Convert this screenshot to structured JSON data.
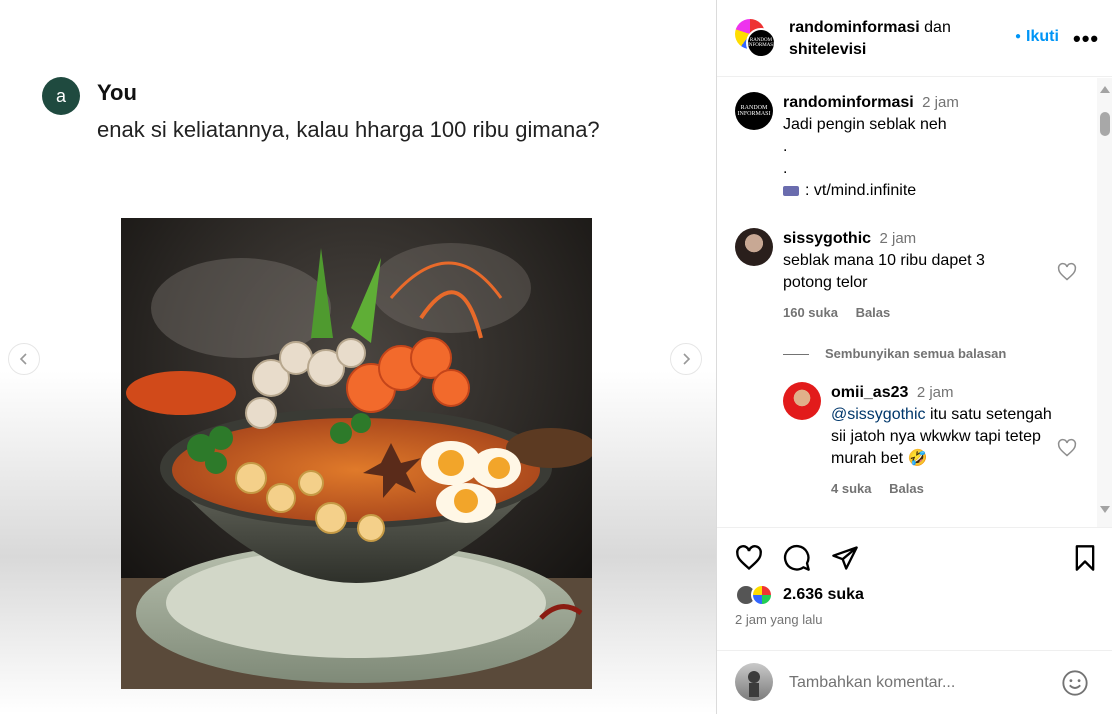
{
  "chat": {
    "avatar_letter": "a",
    "name": "You",
    "message": "enak si keliatannya, kalau hharga 100 ribu gimana?"
  },
  "post": {
    "author": "randominformasi",
    "connector": "dan",
    "coauthor": "shitelevisi",
    "follow_label": "Ikuti",
    "avatar_text": "RANDOM INFORMASI"
  },
  "comments": [
    {
      "user": "randominformasi",
      "time": "2 jam",
      "line1": "Jadi pengin seblak neh",
      "line2": ".",
      "line3": ".",
      "credit": ": vt/mind.infinite"
    },
    {
      "user": "sissygothic",
      "time": "2 jam",
      "text": "seblak mana 10 ribu dapet 3 potong telor",
      "likes": "160 suka",
      "reply": "Balas"
    },
    {
      "user": "omii_as23",
      "time": "2 jam",
      "mention": "@sissygothic",
      "text": "itu satu setengah sii jatoh nya wkwkw tapi tetep murah bet",
      "emoji": "🤣",
      "likes": "4 suka",
      "reply": "Balas"
    }
  ],
  "hide_replies": "Sembunyikan semua balasan",
  "likes_total": "2.636 suka",
  "posted_ago": "2 jam yang lalu",
  "add_comment_placeholder": "Tambahkan komentar...",
  "icons": [
    "heart-icon",
    "comment-icon",
    "share-icon",
    "bookmark-icon",
    "emoji-icon",
    "more-icon",
    "chevron-left-icon",
    "chevron-right-icon"
  ],
  "colors": {
    "link": "#0095f6",
    "mention": "#00376b",
    "muted": "#737373"
  }
}
